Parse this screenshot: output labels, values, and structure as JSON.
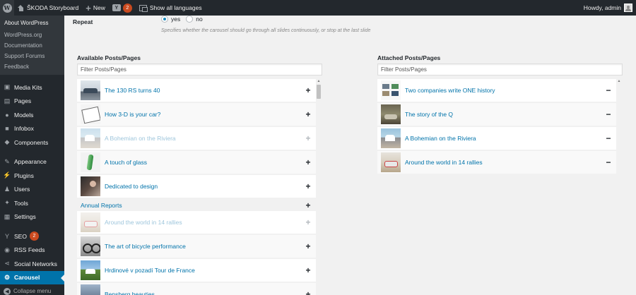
{
  "adminbar": {
    "site_name": "ŠKODA Storyboard",
    "new_label": "New",
    "seo_count": "2",
    "languages_label": "Show all languages",
    "greeting": "Howdy, admin"
  },
  "sidebar": {
    "wp_submenu": [
      "About WordPress",
      "WordPress.org",
      "Documentation",
      "Support Forums",
      "Feedback"
    ],
    "items": [
      {
        "label": "Media Kits",
        "icon": "media-icon"
      },
      {
        "label": "Pages",
        "icon": "pages-icon"
      },
      {
        "label": "Models",
        "icon": "car-icon"
      },
      {
        "label": "Infobox",
        "icon": "infobox-icon"
      },
      {
        "label": "Components",
        "icon": "components-icon"
      },
      {
        "label": "Appearance",
        "icon": "brush-icon"
      },
      {
        "label": "Plugins",
        "icon": "plugin-icon"
      },
      {
        "label": "Users",
        "icon": "users-icon"
      },
      {
        "label": "Tools",
        "icon": "wrench-icon"
      },
      {
        "label": "Settings",
        "icon": "settings-icon"
      },
      {
        "label": "SEO",
        "icon": "seo-icon",
        "badge": "2"
      },
      {
        "label": "RSS Feeds",
        "icon": "rss-icon"
      },
      {
        "label": "Social Networks",
        "icon": "share-icon"
      },
      {
        "label": "Carousel",
        "icon": "carousel-icon",
        "active": true
      }
    ],
    "collapse_label": "Collapse menu"
  },
  "repeat": {
    "label": "Repeat",
    "options": [
      "yes",
      "no"
    ],
    "selected": "yes",
    "hint": "Specifies whether the carousel should go through all slides continuously, or stop at the last slide"
  },
  "available": {
    "title": "Available Posts/Pages",
    "filter_placeholder": "Filter Posts/Pages",
    "items": [
      {
        "title": "The 130 RS turns 40",
        "thumb": "t-car1",
        "dim": false
      },
      {
        "title": "How 3-D is your car?",
        "thumb": "t-sketch",
        "dim": false
      },
      {
        "title": "A Bohemian on the Riviera",
        "thumb": "t-bohem",
        "dim": true
      },
      {
        "title": "A touch of glass",
        "thumb": "t-glass",
        "dim": false
      },
      {
        "title": "Dedicated to design",
        "thumb": "t-design",
        "dim": false
      },
      {
        "title": "Annual Reports",
        "thumb": "",
        "dim": false
      },
      {
        "title": "Around the world in 14 rallies",
        "thumb": "t-rally",
        "dim": true
      },
      {
        "title": "The art of bicycle performance",
        "thumb": "t-bike",
        "dim": false
      },
      {
        "title": "Hrdinové v pozadí Tour de France",
        "thumb": "t-tour",
        "dim": false
      },
      {
        "title": "Bensberg beauties",
        "thumb": "t-bens",
        "dim": false
      }
    ]
  },
  "attached": {
    "title": "Attached Posts/Pages",
    "filter_placeholder": "Filter Posts/Pages",
    "items": [
      {
        "title": "Two companies write ONE history",
        "thumb": "t-two"
      },
      {
        "title": "The story of the Q",
        "thumb": "t-q"
      },
      {
        "title": "A Bohemian on the Riviera",
        "thumb": "t-bohem"
      },
      {
        "title": "Around the world in 14 rallies",
        "thumb": "t-rally"
      }
    ]
  },
  "colors": {
    "accent": "#0073aa",
    "adminbar": "#23282d",
    "badge": "#ca4a1f"
  }
}
